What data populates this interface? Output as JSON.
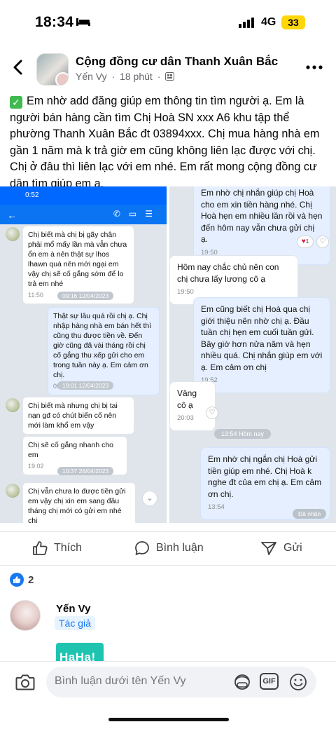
{
  "status_bar": {
    "time": "18:34",
    "network": "4G",
    "battery": "33",
    "battery_color": "#ffd60a"
  },
  "post": {
    "group_name": "Cộng đồng cư dân Thanh Xuân Bắc",
    "author": "Yến Vy",
    "time_ago": "18 phút",
    "text": "Em nhờ add đăng giúp em thông tin tìm người ạ. Em là người bán hàng cần tìm Chị Hoà SN xxx A6 khu tập thể phường Thanh Xuân Bắc đt 03894xxx. Chị mua hàng nhà em gần 1 năm mà k trả giờ em cũng không liên lạc  được với chị. Chị ở đâu thì liên lạc với em nhé. Em rất mong cộng đồng cư dân tìm giúp em ạ."
  },
  "chat_left": {
    "status_time": "0:52",
    "accent": "#0068ff",
    "messages": [
      {
        "text": "Chị biết mà chị bị gãy chân phải mổ mấy lần mà vẫn chưa ổn em à nên thật sự lhos lhawn quá nên mới ngại em vậy chị sẽ cố gắng sớm để lo trả em nhé",
        "time": "11:50"
      },
      {
        "date": "09:16 12/04/2023"
      },
      {
        "text": "Thật sự lâu quá rồi chị ạ. Chị nhập hàng nhà em bán hết thì cũng thu được tiền về. Đến giờ cũng đã vài tháng rồi chị cố gắng thu xếp gửi cho em trong tuần này ạ. Em cảm ơn chị.",
        "time": "09:16"
      },
      {
        "date": "19:01 12/04/2023"
      },
      {
        "text": "Chị biết mà nhưng chị bị tai nạn gđ có chút biến cố nên mới làm khổ em vậy",
        "time": ""
      },
      {
        "text": "Chị sẽ cố gắng nhanh cho em",
        "time": "19:02"
      },
      {
        "date": "10:37 26/04/2023"
      },
      {
        "text": "Chị vẫn chưa lo được tiền gửi em vậy chị xin em sang đầu tháng chị mới có gửi em nhé chị",
        "time": ""
      }
    ]
  },
  "chat_right": {
    "messages": [
      {
        "text": "Em nhờ chị nhắn giúp  chị Hoà cho em xin tiền hàng nhé. Chị Hoà hẹn em nhiều lần rồi và hẹn đến hôm nay vẫn chưa gửi chị ạ.",
        "time": "19:50",
        "reaction": "1"
      },
      {
        "text": "Hôm nay chắc chủ nên con chị chưa lấy lương cô ạ",
        "time": "19:50"
      },
      {
        "text": "Em cũng biết chị Hoà qua chị giới thiệu nên nhờ chị ạ. Đầu tuần chị hẹn em cuối tuần gửi. Bây giờ hơn nửa năm và hẹn nhiều quá. Chị nhắn giúp em với ạ. Em cảm ơn chị",
        "time": "19:52"
      },
      {
        "text": "Vâng cô ạ",
        "time": "20:03"
      },
      {
        "date": "13:54 Hôm nay"
      },
      {
        "text": "Em nhờ chị ngắn chị Hoà gửi tiền giúp em nhé. Chị Hoà k nghe đt của em chị ạ. Em cảm ơn chị.",
        "time": "13:54"
      },
      {
        "seen": "Đã nhận"
      }
    ]
  },
  "actions": {
    "like": "Thích",
    "comment": "Bình luận",
    "share": "Gửi"
  },
  "reactions": {
    "count": "2",
    "color": "#1877f2"
  },
  "comment": {
    "name": "Yến Vy",
    "badge": "Tác giả",
    "sticker_text": "HaHa!"
  },
  "composer": {
    "placeholder": "Bình luận dưới tên Yến Vy",
    "gif_label": "GIF"
  }
}
